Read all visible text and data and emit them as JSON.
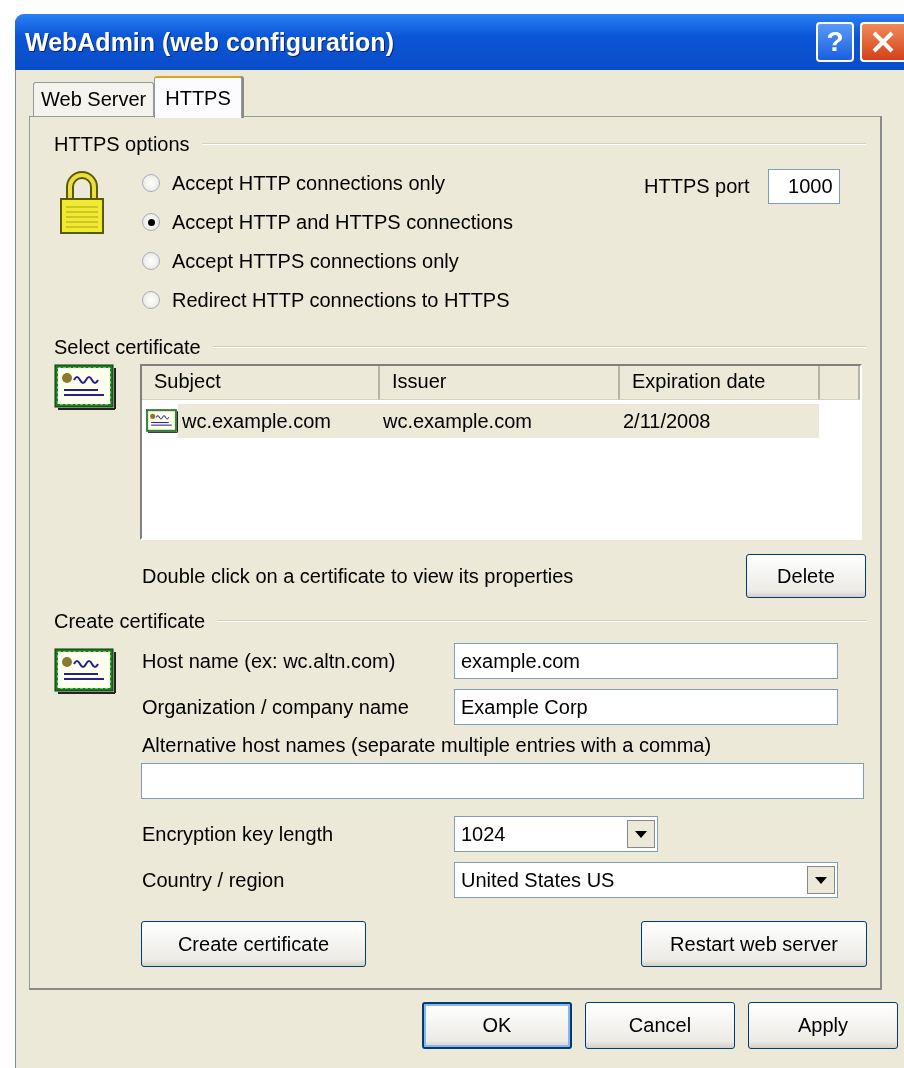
{
  "window": {
    "title": "WebAdmin (web configuration)",
    "help_label": "?"
  },
  "tabs": [
    {
      "label": "Web Server",
      "selected": false
    },
    {
      "label": "HTTPS",
      "selected": true
    }
  ],
  "https_options": {
    "title": "HTTPS options",
    "options": [
      {
        "label": "Accept HTTP connections only",
        "selected": false
      },
      {
        "label": "Accept HTTP and HTTPS connections",
        "selected": true
      },
      {
        "label": "Accept HTTPS connections only",
        "selected": false
      },
      {
        "label": "Redirect HTTP connections to HTTPS",
        "selected": false
      }
    ],
    "port_label": "HTTPS port",
    "port_value": "1000"
  },
  "select_certificate": {
    "title": "Select certificate",
    "columns": [
      "Subject",
      "Issuer",
      "Expiration date"
    ],
    "rows": [
      {
        "cells": [
          "wc.example.com",
          "wc.example.com",
          "2/11/2008"
        ],
        "selected": true
      }
    ],
    "hint": "Double click on a certificate to view its properties",
    "delete_button": "Delete"
  },
  "create_certificate": {
    "title": "Create certificate",
    "host_label": "Host name (ex: wc.altn.com)",
    "host_value": "example.com",
    "org_label": "Organization / company name",
    "org_value": "Example Corp",
    "alt_label": "Alternative host names (separate multiple entries with a comma)",
    "key_length_label": "Encryption key length",
    "key_length_value": "1024",
    "country_label": "Country / region",
    "country_value": "United States US",
    "create_button": "Create certificate",
    "restart_button": "Restart web server"
  },
  "buttons": [
    {
      "label": "OK",
      "default": true
    },
    {
      "label": "Cancel",
      "default": false
    },
    {
      "label": "Apply",
      "default": false
    }
  ]
}
